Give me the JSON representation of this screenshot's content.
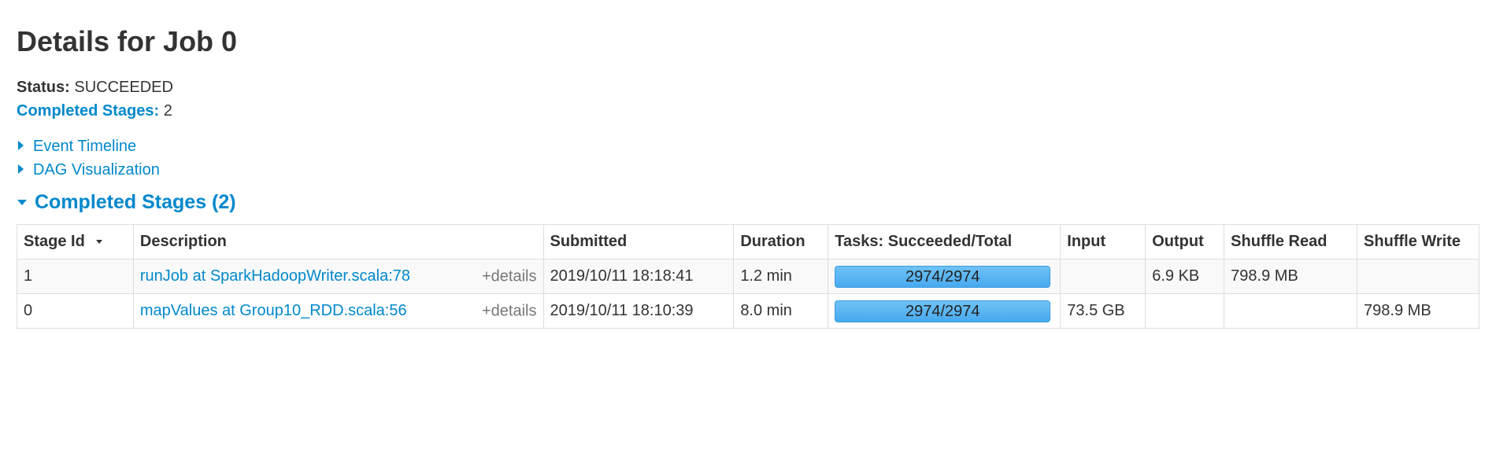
{
  "page": {
    "title": "Details for Job 0"
  },
  "summary": {
    "status_label": "Status:",
    "status_value": "SUCCEEDED",
    "completed_label": "Completed Stages:",
    "completed_value": "2"
  },
  "expanders": {
    "event_timeline": "Event Timeline",
    "dag_visualization": "DAG Visualization"
  },
  "section": {
    "title": "Completed Stages (2)"
  },
  "table": {
    "headers": {
      "stage_id": "Stage Id",
      "description": "Description",
      "submitted": "Submitted",
      "duration": "Duration",
      "tasks": "Tasks: Succeeded/Total",
      "input": "Input",
      "output": "Output",
      "shuffle_read": "Shuffle Read",
      "shuffle_write": "Shuffle Write"
    },
    "rows": [
      {
        "stage_id": "1",
        "description": "runJob at SparkHadoopWriter.scala:78",
        "details": "+details",
        "submitted": "2019/10/11 18:18:41",
        "duration": "1.2 min",
        "tasks": "2974/2974",
        "tasks_fraction": 1.0,
        "input": "",
        "output": "6.9 KB",
        "shuffle_read": "798.9 MB",
        "shuffle_write": ""
      },
      {
        "stage_id": "0",
        "description": "mapValues at Group10_RDD.scala:56",
        "details": "+details",
        "submitted": "2019/10/11 18:10:39",
        "duration": "8.0 min",
        "tasks": "2974/2974",
        "tasks_fraction": 1.0,
        "input": "73.5 GB",
        "output": "",
        "shuffle_read": "",
        "shuffle_write": "798.9 MB"
      }
    ]
  },
  "colors": {
    "link": "#0088cc",
    "text": "#333333",
    "progress": "#5bb7f2",
    "border": "#dddddd"
  },
  "icons": {
    "expander_collapsed": "triangle-right-icon",
    "expander_expanded": "triangle-down-icon",
    "sort": "sort-desc-icon"
  }
}
